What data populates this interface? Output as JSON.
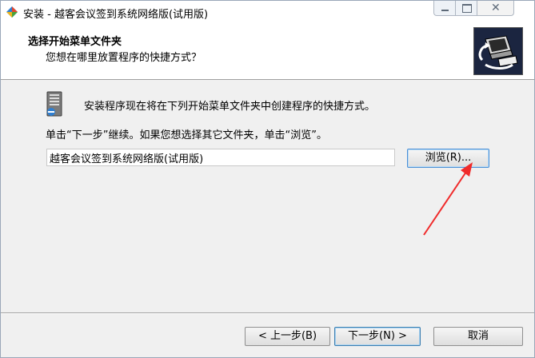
{
  "window": {
    "title": "安装 - 越客会议签到系统网络版(试用版)",
    "close_glyph": "✕",
    "app_icon": "installer-icon",
    "colors": {
      "title_bg": "#ffffff",
      "body_bg": "#f0f0f0",
      "accent": "#3c7fb1",
      "arrow": "#f02a2a"
    }
  },
  "header": {
    "title": "选择开始菜单文件夹",
    "subtitle": "您想在哪里放置程序的快捷方式？",
    "image": "computer-setup-image"
  },
  "body": {
    "intro": "安装程序现在将在下列开始菜单文件夹中创建程序的快捷方式。",
    "hint": "单击“下一步”继续。如果您想选择其它文件夹，单击“浏览”。",
    "folder_value": "越客会议签到系统网络版(试用版)",
    "browse_label": "浏览(R)..."
  },
  "footer": {
    "back_label": "< 上一步(B)",
    "next_label": "下一步(N) >",
    "cancel_label": "取消"
  }
}
